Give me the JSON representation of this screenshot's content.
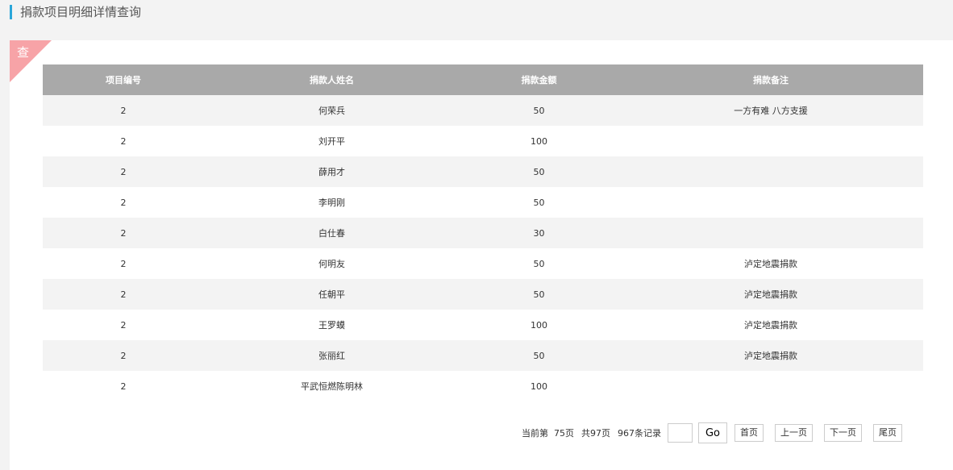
{
  "page": {
    "title": "捐款项目明细详情查询"
  },
  "panel": {
    "corner_label": "查"
  },
  "table": {
    "headers": [
      "项目编号",
      "捐款人姓名",
      "捐款金额",
      "捐款备注"
    ],
    "rows": [
      [
        "2",
        "何荣兵",
        "50",
        "一方有难 八方支援"
      ],
      [
        "2",
        "刘开平",
        "100",
        ""
      ],
      [
        "2",
        "薛用才",
        "50",
        ""
      ],
      [
        "2",
        "李明刚",
        "50",
        ""
      ],
      [
        "2",
        "白仕春",
        "30",
        ""
      ],
      [
        "2",
        "何明友",
        "50",
        "泸定地震捐款"
      ],
      [
        "2",
        "任朝平",
        "50",
        "泸定地震捐款"
      ],
      [
        "2",
        "王罗蟆",
        "100",
        "泸定地震捐款"
      ],
      [
        "2",
        "张丽红",
        "50",
        "泸定地震捐款"
      ],
      [
        "2",
        "平武恒燃陈明林",
        "100",
        ""
      ]
    ]
  },
  "pager": {
    "current": "当前第  75页",
    "total_pages": "共97页",
    "total_records": "967条记录",
    "jump_value": "",
    "go_label": "Go",
    "first_label": "首页",
    "prev_label": "上一页",
    "next_label": "下一页",
    "last_label": "尾页"
  }
}
